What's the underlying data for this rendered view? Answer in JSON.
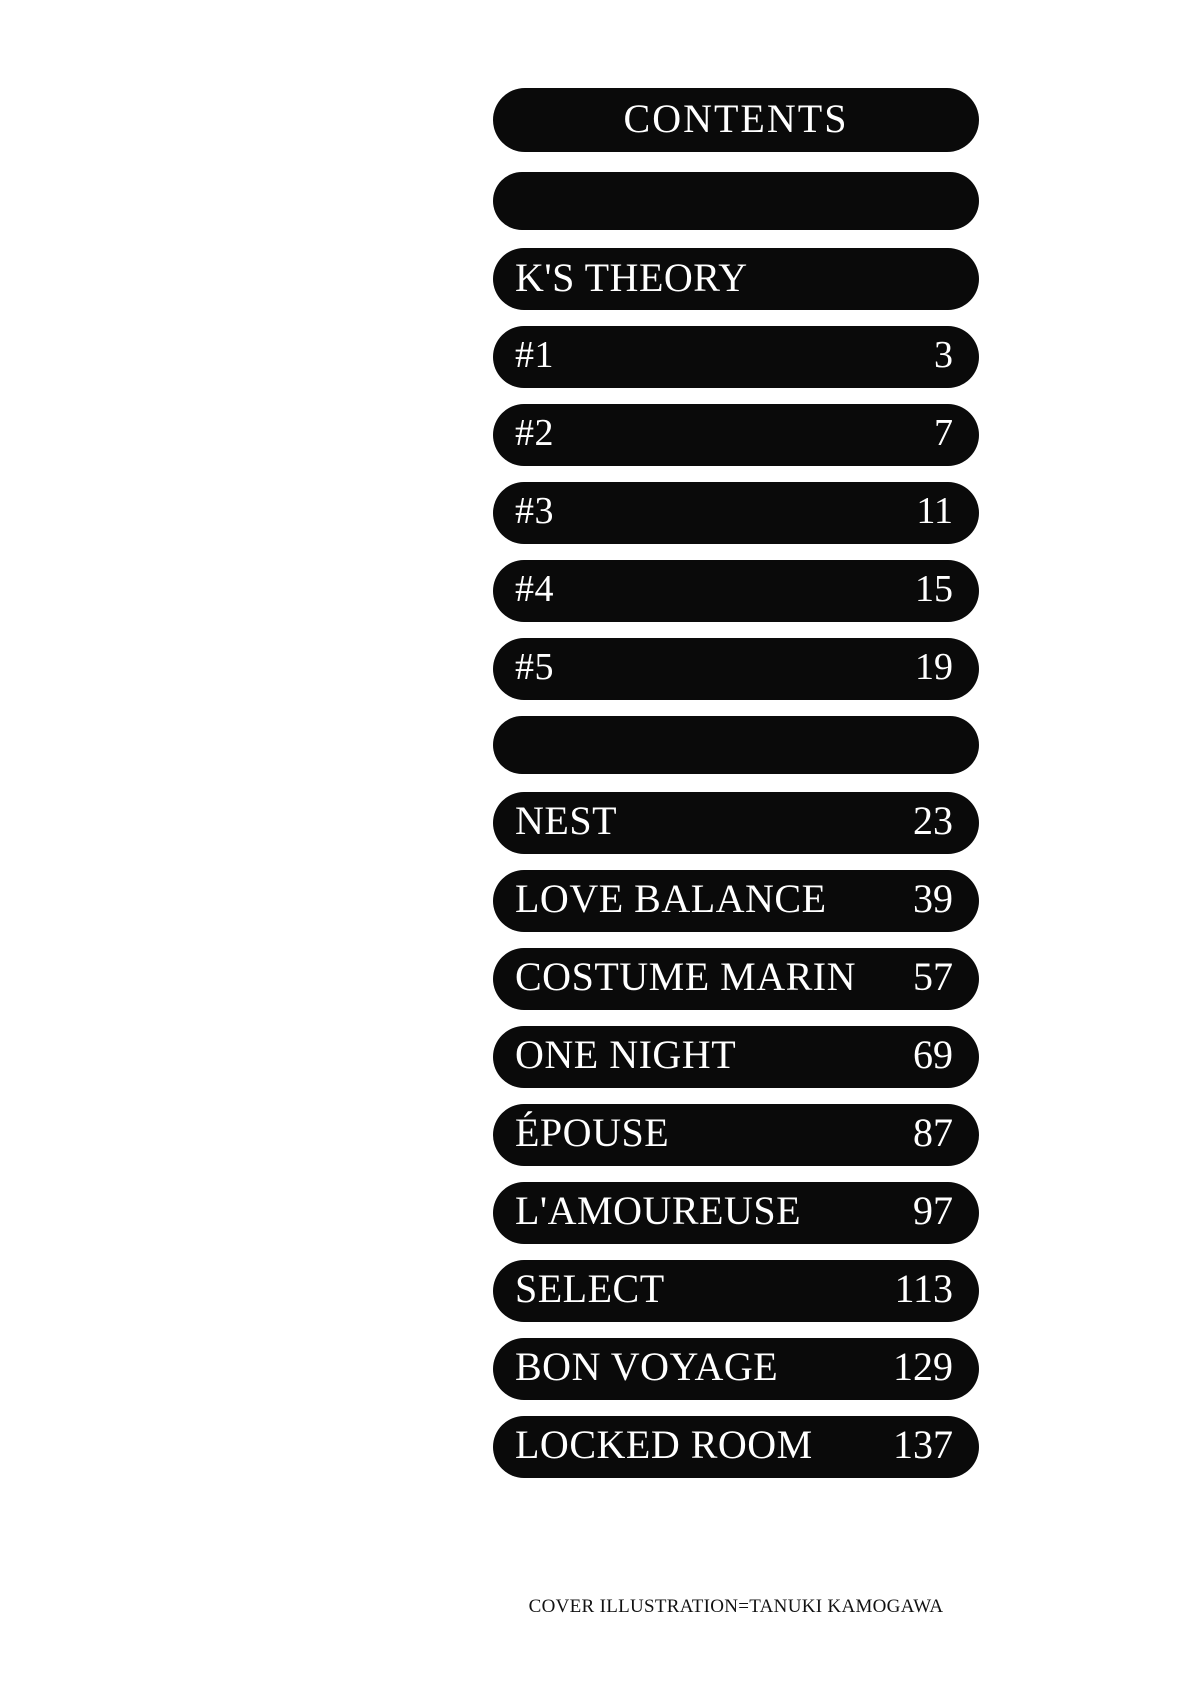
{
  "page": {
    "background_color": "#ffffff",
    "bar_color": "#0a0a0a",
    "bar_text_color": "#ffffff",
    "credit_text_color": "#111111"
  },
  "header": {
    "title": "CONTENTS"
  },
  "spacer_top": {
    "title": ""
  },
  "section": {
    "title": "K'S THEORY"
  },
  "chapters": [
    {
      "title": "#1",
      "page": "3"
    },
    {
      "title": "#2",
      "page": "7"
    },
    {
      "title": "#3",
      "page": "11"
    },
    {
      "title": "#4",
      "page": "15"
    },
    {
      "title": "#5",
      "page": "19"
    }
  ],
  "spacer_mid": {
    "title": ""
  },
  "stories": [
    {
      "title": "NEST",
      "page": "23"
    },
    {
      "title": "LOVE BALANCE",
      "page": "39"
    },
    {
      "title": "COSTUME MARIN",
      "page": "57"
    },
    {
      "title": "ONE NIGHT",
      "page": "69"
    },
    {
      "title": "ÉPOUSE",
      "page": "87"
    },
    {
      "title": "L'AMOUREUSE",
      "page": "97"
    },
    {
      "title": "SELECT",
      "page": "113"
    },
    {
      "title": "BON VOYAGE",
      "page": "129"
    },
    {
      "title": "LOCKED ROOM",
      "page": "137"
    }
  ],
  "credit": {
    "text": "COVER ILLUSTRATION=TANUKI KAMOGAWA"
  }
}
